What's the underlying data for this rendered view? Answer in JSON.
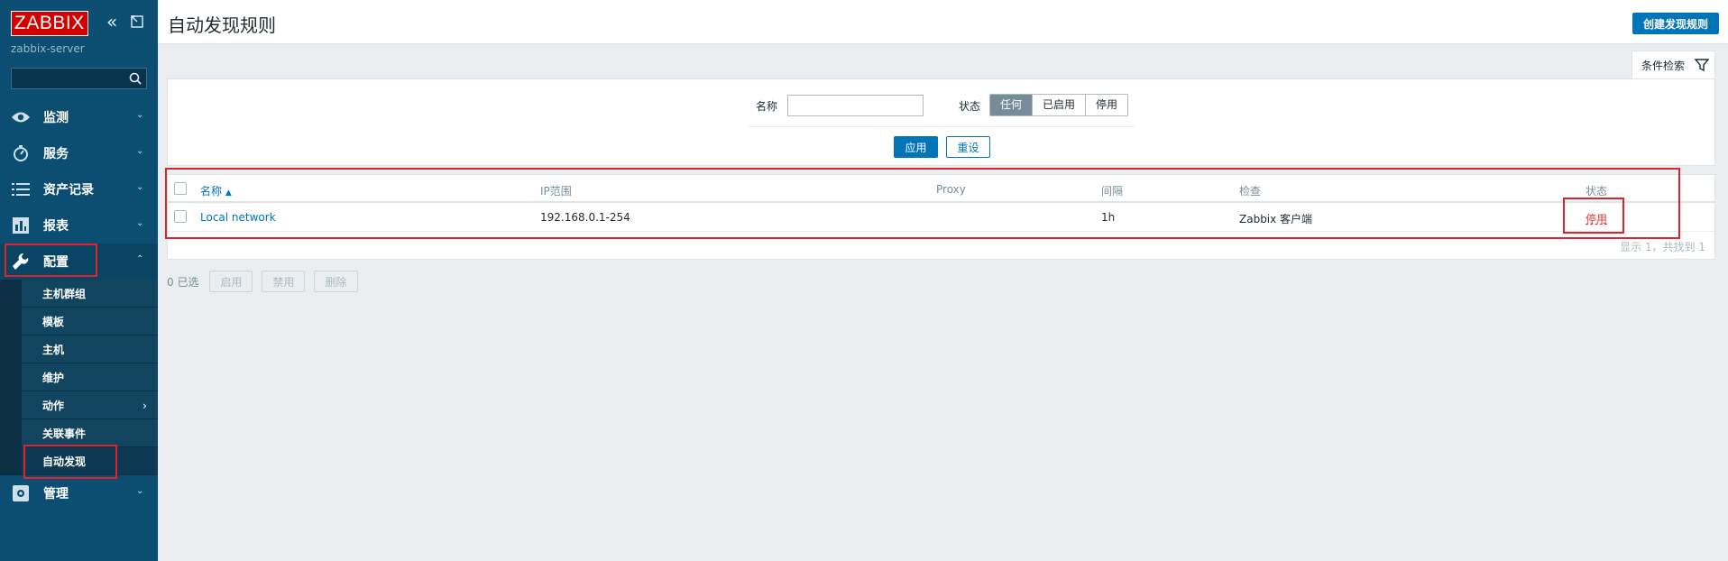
{
  "sidebar": {
    "logo": "ZABBIX",
    "server": "zabbix-server",
    "search_placeholder": "",
    "menu": [
      {
        "label": "监测",
        "icon": "eye-icon"
      },
      {
        "label": "服务",
        "icon": "clock-icon"
      },
      {
        "label": "资产记录",
        "icon": "list-icon"
      },
      {
        "label": "报表",
        "icon": "bar-chart-icon"
      },
      {
        "label": "配置",
        "icon": "wrench-icon"
      },
      {
        "label": "管理",
        "icon": "gear-icon"
      }
    ],
    "submenu": [
      "主机群组",
      "模板",
      "主机",
      "维护",
      "动作",
      "关联事件",
      "自动发现"
    ]
  },
  "header": {
    "title": "自动发现规则",
    "create_button": "创建发现规则"
  },
  "filter": {
    "tab_label": "条件检索",
    "name_label": "名称",
    "name_value": "",
    "status_label": "状态",
    "status_options": [
      "任何",
      "已启用",
      "停用"
    ],
    "status_selected": "任何",
    "apply": "应用",
    "reset": "重设"
  },
  "table": {
    "columns": [
      "名称",
      "IP范围",
      "Proxy",
      "间隔",
      "检查",
      "状态"
    ],
    "sort_arrow": "▲",
    "rows": [
      {
        "name": "Local network",
        "ip_range": "192.168.0.1-254",
        "proxy": "",
        "interval": "1h",
        "checks": "Zabbix 客户端",
        "status": "停用"
      }
    ],
    "summary": "显示 1，共找到 1"
  },
  "actions": {
    "selected": "0 已选",
    "buttons": [
      "启用",
      "禁用",
      "删除"
    ]
  },
  "colors": {
    "sidebar": "#0b4e72",
    "accent": "#0275b8",
    "disabled_status": "#e33734",
    "annotation": "#e0222c"
  }
}
